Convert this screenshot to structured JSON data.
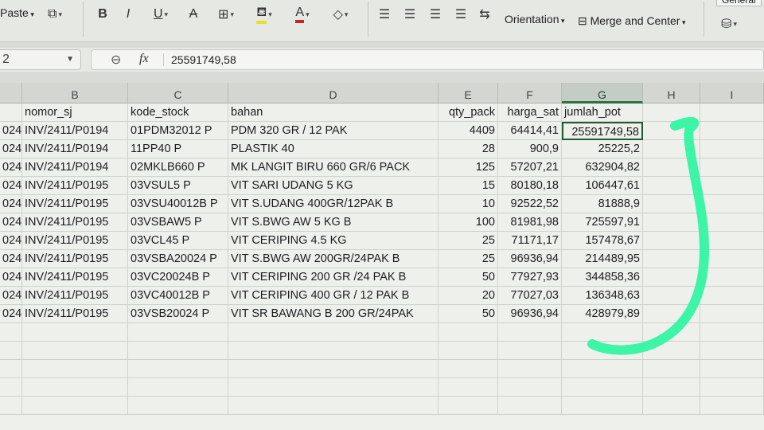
{
  "ribbon": {
    "paste_label": "Paste",
    "bold": "B",
    "italic": "I",
    "underline": "U",
    "strike": "A",
    "font_color": "A",
    "orientation_label": "Orientation",
    "merge_label": "Merge and Center",
    "general_label": "General"
  },
  "formula_bar": {
    "name_box": "2",
    "fx": "fx",
    "value": "25591749,58"
  },
  "columns": [
    {
      "letter": "B"
    },
    {
      "letter": "C"
    },
    {
      "letter": "D"
    },
    {
      "letter": "E"
    },
    {
      "letter": "F"
    },
    {
      "letter": "G"
    },
    {
      "letter": "H"
    },
    {
      "letter": "I"
    }
  ],
  "headers": {
    "nomor_sj": "nomor_sj",
    "kode_stock": "kode_stock",
    "bahan": "bahan",
    "qty_pack": "qty_pack",
    "harga_sat": "harga_sat",
    "jumlah_pot": "jumlah_pot"
  },
  "rows": [
    {
      "a": "024",
      "b": "INV/2411/P0194",
      "c": "01PDM32012  P",
      "d": "PDM 320 GR / 12 PAK",
      "e": "4409",
      "f": "64414,41",
      "g": "25591749,58"
    },
    {
      "a": "024",
      "b": "INV/2411/P0194",
      "c": "11PP40     P",
      "d": "PLASTIK 40",
      "e": "28",
      "f": "900,9",
      "g": "25225,2"
    },
    {
      "a": "024",
      "b": "INV/2411/P0194",
      "c": "02MKLB660   P",
      "d": "MK LANGIT BIRU 660 GR/6 PACK",
      "e": "125",
      "f": "57207,21",
      "g": "632904,82"
    },
    {
      "a": "024",
      "b": "INV/2411/P0195",
      "c": "03VSUL5    P",
      "d": "VIT SARI UDANG 5 KG",
      "e": "15",
      "f": "80180,18",
      "g": "106447,61"
    },
    {
      "a": "024",
      "b": "INV/2411/P0195",
      "c": "03VSU40012B P",
      "d": "VIT S.UDANG 400GR/12PAK B",
      "e": "10",
      "f": "92522,52",
      "g": "81888,9"
    },
    {
      "a": "024",
      "b": "INV/2411/P0195",
      "c": "03VSBAW5   P",
      "d": "VIT S.BWG AW 5 KG B",
      "e": "100",
      "f": "81981,98",
      "g": "725597,91"
    },
    {
      "a": "024",
      "b": "INV/2411/P0195",
      "c": "03VCL45    P",
      "d": "VIT CERIPING 4.5 KG",
      "e": "25",
      "f": "71171,17",
      "g": "157478,67"
    },
    {
      "a": "024",
      "b": "INV/2411/P0195",
      "c": "03VSBA20024  P",
      "d": "VIT S.BWG AW 200GR/24PAK B",
      "e": "25",
      "f": "96936,94",
      "g": "214489,95"
    },
    {
      "a": "024",
      "b": "INV/2411/P0195",
      "c": "03VC20024B  P",
      "d": "VIT CERIPING 200 GR /24 PAK B",
      "e": "50",
      "f": "77927,93",
      "g": "344858,36"
    },
    {
      "a": "024",
      "b": "INV/2411/P0195",
      "c": "03VC40012B  P",
      "d": "VIT CERIPING 400 GR / 12 PAK B",
      "e": "20",
      "f": "77027,03",
      "g": "136348,63"
    },
    {
      "a": "024",
      "b": "INV/2411/P0195",
      "c": "03VSB20024  P",
      "d": "VIT SR BAWANG B 200 GR/24PAK",
      "e": "50",
      "f": "96936,94",
      "g": "428979,89"
    }
  ],
  "colors": {
    "selection": "#1f5a33",
    "annotation": "#2ef5a0"
  }
}
